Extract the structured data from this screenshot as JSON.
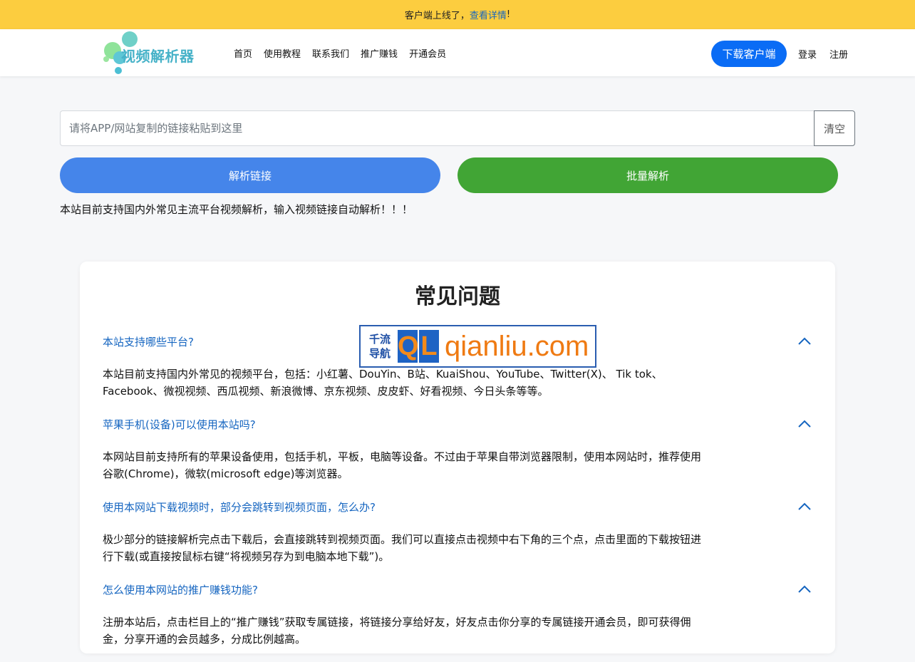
{
  "announcement": {
    "text": "客户端上线了，",
    "link": "查看详情",
    "suffix": "!"
  },
  "navbar": {
    "logo_text": "视频解析器",
    "links": [
      "首页",
      "使用教程",
      "联系我们",
      "推广赚钱",
      "开通会员"
    ],
    "download_label": "下载客户端",
    "login_label": "登录",
    "register_label": "注册"
  },
  "parser": {
    "placeholder": "请将APP/网站复制的链接粘贴到这里",
    "value": "",
    "clear_label": "清空",
    "parse_label": "解析链接",
    "batch_label": "批量解析",
    "note": "本站目前支持国内外常见主流平台视频解析，输入视频链接自动解析！！！"
  },
  "faq": {
    "title": "常见问题",
    "items": [
      {
        "question": "本站支持哪些平台?",
        "answer": "本站目前支持国内外常见的视频平台，包括：小红薯、DouYin、B站、KuaiShou、YouTube、Twitter(X)、 Tik tok、Facebook、微视视频、西瓜视频、新浪微博、京东视频、皮皮虾、好看视频、今日头条等等。"
      },
      {
        "question": "苹果手机(设备)可以使用本站吗?",
        "answer": "本网站目前支持所有的苹果设备使用，包括手机，平板，电脑等设备。不过由于苹果自带浏览器限制，使用本网站时，推荐使用谷歌(Chrome)，微软(microsoft edge)等浏览器。"
      },
      {
        "question": "使用本网站下载视频时，部分会跳转到视频页面，怎么办?",
        "answer": "极少部分的链接解析完点击下载后，会直接跳转到视频页面。我们可以直接点击视频中右下角的三个点，点击里面的下载按钮进行下载(或直接按鼠标右键“将视频另存为到电脑本地下载”)。"
      },
      {
        "question": "怎么使用本网站的推广赚钱功能?",
        "answer": "注册本站后，点击栏目上的“推广赚钱”获取专属链接，将链接分享给好友，好友点击你分享的专属链接开通会员，即可获得佣金，分享开通的会员越多，分成比例越高。"
      }
    ]
  },
  "watermark": {
    "cn_top": "千流",
    "cn_bottom": "导航",
    "letters": [
      "Q",
      "L"
    ],
    "domain": "qianliu.com"
  },
  "colors": {
    "announce_bg": "#fccd3f",
    "primary": "#0a6cf5",
    "parse_btn": "#4585ea",
    "batch_btn": "#41a535",
    "link": "#1565c0"
  }
}
